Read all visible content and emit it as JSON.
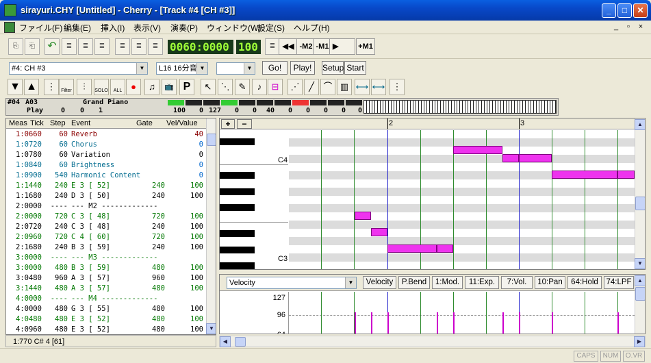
{
  "window": {
    "title": "sirayuri.CHY [Untitled] - Cherry  - [Track #4 [CH #3]]",
    "minimize": "_",
    "maximize": "□",
    "close": "✕"
  },
  "menu": [
    "ファイル(F)",
    "編集(E)",
    "挿入(I)",
    "表示(V)",
    "演奏(P)",
    "ウィンドウ(W)",
    "設定(S)",
    "ヘルプ(H)"
  ],
  "mdi_controls": [
    "_",
    "▫",
    "×"
  ],
  "toolbar": {
    "position": "0060:0000",
    "tempo": "100",
    "transport": [
      "◀◀",
      "-M2",
      "-M1",
      "▶",
      "+M1"
    ]
  },
  "track_bar": {
    "track_select": "#4: CH #3",
    "quantize_select": "L16 16分音",
    "extra_select": "",
    "buttons": [
      "Go!",
      "Play!",
      "Setup",
      "Start"
    ]
  },
  "tools": [
    "▼",
    "▲",
    "⋮",
    "Filter",
    "⫶",
    "SOLO",
    "ALL",
    "●",
    "♫",
    "📺",
    "P",
    "↖",
    "⋱",
    "✎",
    "♪",
    "⊟",
    "⋰",
    "╱",
    "⌒",
    "▥",
    "⟷",
    "⟷",
    "⋮"
  ],
  "trackinfo": {
    "track_id": "#04",
    "patch": "A03",
    "instrument": "Grand Piano",
    "play_label": "Play",
    "play_values": [
      "0",
      "0",
      "1"
    ],
    "vals": [
      "100",
      "0",
      "127",
      "0",
      "0",
      "40",
      "0",
      "0",
      "0",
      "0",
      "0"
    ]
  },
  "eventlist": {
    "headers": [
      "Meas",
      "Tick",
      "Step",
      "Event",
      "Gate",
      "Vel/Value"
    ],
    "rows": [
      {
        "pos": "1:0660",
        "step": "60",
        "event": "Reverb",
        "gate": "",
        "val": "40",
        "color": "#8b0000"
      },
      {
        "pos": "1:0720",
        "step": "60",
        "event": "Chorus",
        "gate": "",
        "val": "0",
        "color": "#006b8f"
      },
      {
        "pos": "1:0780",
        "step": "60",
        "event": "Variation",
        "gate": "",
        "val": "0",
        "color": "#000000"
      },
      {
        "pos": "1:0840",
        "step": "60",
        "event": "Brightness",
        "gate": "",
        "val": "0",
        "color": "#006b8f"
      },
      {
        "pos": "1:0900",
        "step": "540",
        "event": "Harmonic Content",
        "gate": "",
        "val": "0",
        "color": "#006b8f"
      },
      {
        "pos": "1:1440",
        "step": "240",
        "event": "E  3 [ 52]",
        "gate": "240",
        "val": "100",
        "color": "#007700"
      },
      {
        "pos": "1:1680",
        "step": "240",
        "event": "D  3 [ 50]",
        "gate": "240",
        "val": "100",
        "color": "#000000"
      },
      {
        "pos": "2:0000",
        "step": "----",
        "event": "--- M2 -------------",
        "gate": "",
        "val": "",
        "color": "#000000"
      },
      {
        "pos": "2:0000",
        "step": "720",
        "event": "C  3 [ 48]",
        "gate": "720",
        "val": "100",
        "color": "#007700"
      },
      {
        "pos": "2:0720",
        "step": "240",
        "event": "C  3 [ 48]",
        "gate": "240",
        "val": "100",
        "color": "#000000"
      },
      {
        "pos": "2:0960",
        "step": "720",
        "event": "C  4 [ 60]",
        "gate": "720",
        "val": "100",
        "color": "#007700"
      },
      {
        "pos": "2:1680",
        "step": "240",
        "event": "B  3 [ 59]",
        "gate": "240",
        "val": "100",
        "color": "#000000"
      },
      {
        "pos": "3:0000",
        "step": "----",
        "event": "--- M3 -------------",
        "gate": "",
        "val": "",
        "color": "#007700"
      },
      {
        "pos": "3:0000",
        "step": "480",
        "event": "B  3 [ 59]",
        "gate": "480",
        "val": "100",
        "color": "#007700"
      },
      {
        "pos": "3:0480",
        "step": "960",
        "event": "A  3 [ 57]",
        "gate": "960",
        "val": "100",
        "color": "#000000"
      },
      {
        "pos": "3:1440",
        "step": "480",
        "event": "A  3 [ 57]",
        "gate": "480",
        "val": "100",
        "color": "#007700"
      },
      {
        "pos": "4:0000",
        "step": "----",
        "event": "--- M4 -------------",
        "gate": "",
        "val": "",
        "color": "#007700"
      },
      {
        "pos": "4:0000",
        "step": "480",
        "event": "G  3 [ 55]",
        "gate": "480",
        "val": "100",
        "color": "#000000"
      },
      {
        "pos": "4:0480",
        "step": "480",
        "event": "E  3 [ 52]",
        "gate": "480",
        "val": "100",
        "color": "#007700"
      },
      {
        "pos": "4:0960",
        "step": "480",
        "event": "E  3 [ 52]",
        "gate": "480",
        "val": "100",
        "color": "#000000"
      }
    ]
  },
  "status_left": "1:770  C# 4 [61]",
  "pianoroll": {
    "zoom_in": "+",
    "zoom_out": "−",
    "measure_labels": [
      "2",
      "3"
    ],
    "key_labels": [
      "C4",
      "C3"
    ],
    "note_color": "#ee33ee"
  },
  "controller": {
    "select": "Velocity",
    "tabs": [
      "Velocity",
      "P.Bend",
      "1:Mod.",
      "11:Exp.",
      "7:Vol.",
      "10:Pan",
      "64:Hold",
      "74:LPF"
    ],
    "scale": [
      "127",
      "96",
      "64"
    ]
  },
  "indicators": [
    "CAPS",
    "NUM",
    "O.VR"
  ]
}
